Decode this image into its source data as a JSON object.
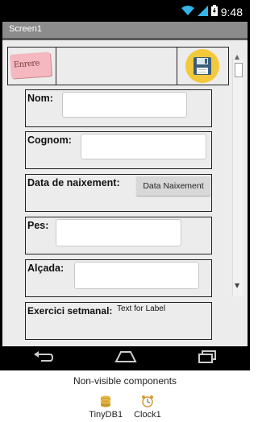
{
  "status": {
    "time": "9:48",
    "icons": [
      "wifi-icon",
      "signal-icon",
      "battery-icon"
    ]
  },
  "screen": {
    "title": "Screen1"
  },
  "toolbar": {
    "back_label": "Enrere",
    "save_icon": "floppy-disk-icon"
  },
  "form": {
    "nom_label": "Nom:",
    "cognom_label": "Cognom:",
    "data_label": "Data de naixement:",
    "data_button": "Data Naixement",
    "pes_label": "Pes:",
    "alcada_label": "Alçada:",
    "exercici_label": "Exercici setmanal:",
    "exercici_value": "Text for Label"
  },
  "nav": {
    "icons": [
      "back-icon",
      "home-icon",
      "recents-icon"
    ]
  },
  "nonvisible": {
    "title": "Non-visible components",
    "items": [
      {
        "label": "TinyDB1",
        "icon": "database-icon"
      },
      {
        "label": "Clock1",
        "icon": "clock-icon"
      }
    ]
  },
  "colors": {
    "accent": "#f2c93a",
    "title_bar": "#8c8c8c",
    "back_button": "#f6b8c0"
  }
}
